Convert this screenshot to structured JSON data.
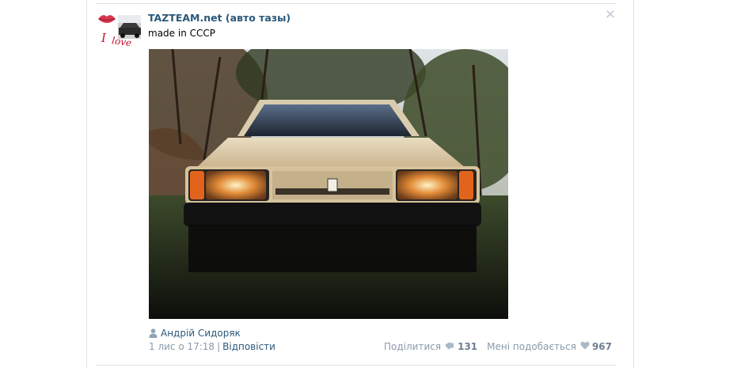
{
  "post": {
    "author": "TAZTEAM.net (авто тазы)",
    "text": "made in СССР",
    "avatar_caption": "I love",
    "photo_author": "Андрій Сидоряк",
    "date": "1 лис о 17:18",
    "separator": "|",
    "reply_label": "Відповісти",
    "share_label": "Поділитися",
    "share_count": "131",
    "like_label": "Мені подобається",
    "like_count": "967",
    "icons": {
      "close": "close-icon",
      "user": "user-icon",
      "share": "megaphone-icon",
      "like": "heart-icon"
    }
  },
  "colors": {
    "link": "#2b587a",
    "muted": "#8a9aab",
    "border": "#dae1e8"
  }
}
